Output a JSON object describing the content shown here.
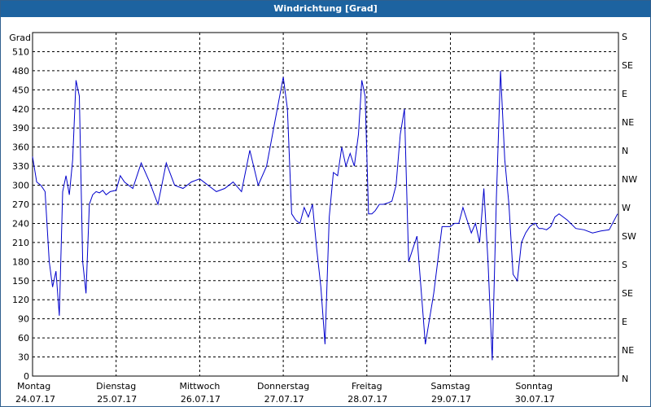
{
  "window": {
    "title": "Windrichtung [Grad]"
  },
  "colors": {
    "titlebar": "#1d63a0",
    "series": "#0000cc",
    "grid": "#000000"
  },
  "chart_data": {
    "type": "line",
    "title": "Windrichtung [Grad]",
    "ylabel": "Grad",
    "ylim": [
      0,
      540
    ],
    "xlim": [
      0,
      7
    ],
    "grid": true,
    "y_ticks": [
      0,
      30,
      60,
      90,
      120,
      150,
      180,
      210,
      240,
      270,
      300,
      330,
      360,
      390,
      420,
      450,
      480,
      510
    ],
    "y2_ticks": [
      {
        "value": 0,
        "label": "N"
      },
      {
        "value": 30,
        "label": "NE"
      },
      {
        "value": 60,
        "label": "E"
      },
      {
        "value": 90,
        "label": "SE"
      },
      {
        "value": 120,
        "label": "S"
      },
      {
        "value": 150,
        "label": "SW"
      },
      {
        "value": 180,
        "label": "W"
      },
      {
        "value": 210,
        "label": "NW"
      },
      {
        "value": 240,
        "label": "N"
      },
      {
        "value": 270,
        "label": "NE"
      },
      {
        "value": 300,
        "label": "E"
      },
      {
        "value": 330,
        "label": "SE"
      },
      {
        "value": 360,
        "label": "S"
      }
    ],
    "x_ticks": [
      {
        "day": "Montag",
        "date": "24.07.17"
      },
      {
        "day": "Dienstag",
        "date": "25.07.17"
      },
      {
        "day": "Mittwoch",
        "date": "26.07.17"
      },
      {
        "day": "Donnerstag",
        "date": "27.07.17"
      },
      {
        "day": "Freitag",
        "date": "28.07.17"
      },
      {
        "day": "Samstag",
        "date": "29.07.17"
      },
      {
        "day": "Sonntag",
        "date": "30.07.17"
      }
    ],
    "series": [
      {
        "x": [
          0,
          0.05,
          0.1,
          0.15,
          0.2,
          0.24,
          0.28,
          0.32,
          0.36,
          0.4,
          0.44,
          0.48,
          0.52,
          0.56,
          0.6,
          0.64,
          0.68,
          0.72,
          0.76,
          0.8,
          0.84,
          0.88,
          0.93,
          1.0,
          1.05,
          1.1,
          1.2,
          1.3,
          1.4,
          1.5,
          1.6,
          1.7,
          1.8,
          1.9,
          2.0,
          2.1,
          2.2,
          2.3,
          2.4,
          2.5,
          2.6,
          2.7,
          2.8,
          2.9,
          3.0,
          3.05,
          3.1,
          3.15,
          3.2,
          3.25,
          3.3,
          3.35,
          3.4,
          3.45,
          3.5,
          3.55,
          3.6,
          3.65,
          3.7,
          3.75,
          3.8,
          3.85,
          3.9,
          3.94,
          3.98,
          4.02,
          4.06,
          4.1,
          4.15,
          4.2,
          4.25,
          4.3,
          4.35,
          4.4,
          4.45,
          4.5,
          4.6,
          4.7,
          4.8,
          4.9,
          5.0,
          5.05,
          5.1,
          5.15,
          5.2,
          5.25,
          5.3,
          5.35,
          5.4,
          5.45,
          5.5,
          5.55,
          5.6,
          5.65,
          5.7,
          5.75,
          5.8,
          5.85,
          5.9,
          5.95,
          6.0,
          6.02,
          6.04,
          6.06,
          6.1,
          6.15,
          6.2,
          6.25,
          6.3,
          6.4,
          6.5,
          6.6,
          6.7,
          6.8,
          6.9,
          7.0
        ],
        "y": [
          345,
          305,
          300,
          290,
          180,
          140,
          165,
          95,
          290,
          315,
          285,
          340,
          465,
          440,
          180,
          130,
          270,
          285,
          290,
          288,
          292,
          285,
          290,
          292,
          315,
          305,
          295,
          335,
          305,
          270,
          335,
          300,
          295,
          305,
          310,
          300,
          290,
          295,
          305,
          290,
          355,
          300,
          330,
          400,
          470,
          420,
          255,
          245,
          240,
          265,
          250,
          270,
          200,
          140,
          50,
          250,
          320,
          315,
          360,
          330,
          350,
          330,
          380,
          465,
          440,
          255,
          255,
          260,
          270,
          270,
          272,
          275,
          300,
          380,
          420,
          180,
          220,
          50,
          130,
          235,
          235,
          240,
          240,
          265,
          245,
          225,
          240,
          210,
          295,
          180,
          25,
          280,
          480,
          340,
          270,
          160,
          150,
          210,
          225,
          235,
          240,
          240,
          235,
          232,
          232,
          230,
          235,
          250,
          255,
          245,
          232,
          230,
          225,
          228,
          230,
          255
        ]
      }
    ]
  }
}
